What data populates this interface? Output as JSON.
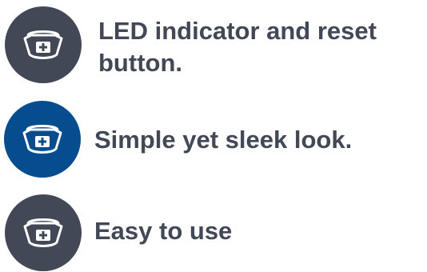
{
  "colors": {
    "badge_dark": "#434856",
    "badge_blue": "#064d8f",
    "icon_stroke": "#ffffff",
    "text": "#434856"
  },
  "features": [
    {
      "icon": "nurse-cap-icon",
      "badge_color": "#434856",
      "text_line1": "LED indicator and reset",
      "text_line2": "button."
    },
    {
      "icon": "nurse-cap-icon",
      "badge_color": "#064d8f",
      "text": "Simple yet sleek look."
    },
    {
      "icon": "nurse-cap-icon",
      "badge_color": "#434856",
      "text": "Easy to use"
    }
  ]
}
